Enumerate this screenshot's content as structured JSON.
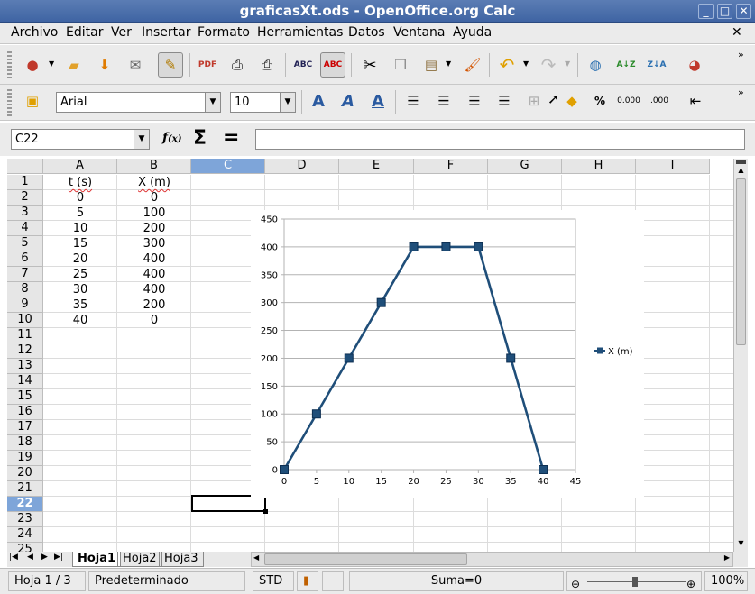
{
  "window": {
    "title": "graficasXt.ods - OpenOffice.org Calc"
  },
  "menu": [
    {
      "label": "Archivo"
    },
    {
      "label": "Editar"
    },
    {
      "label": "Ver"
    },
    {
      "label": "Insertar"
    },
    {
      "label": "Formato"
    },
    {
      "label": "Herramientas"
    },
    {
      "label": "Datos"
    },
    {
      "label": "Ventana"
    },
    {
      "label": "Ayuda"
    }
  ],
  "format_toolbar": {
    "font_name": "Arial",
    "font_size": "10"
  },
  "formula_bar": {
    "cell_ref": "C22",
    "value": ""
  },
  "sheet": {
    "columns": [
      "A",
      "B",
      "C",
      "D",
      "E",
      "F",
      "G",
      "H",
      "I"
    ],
    "selected_column": "C",
    "rows": [
      "1",
      "2",
      "3",
      "4",
      "5",
      "6",
      "7",
      "8",
      "9",
      "10",
      "11",
      "12",
      "13",
      "14",
      "15",
      "16",
      "17",
      "18",
      "19",
      "20",
      "21",
      "22",
      "23",
      "24",
      "25"
    ],
    "selected_row": "22",
    "table": [
      [
        "t (s)",
        "X (m)"
      ],
      [
        "0",
        "0"
      ],
      [
        "5",
        "100"
      ],
      [
        "10",
        "200"
      ],
      [
        "15",
        "300"
      ],
      [
        "20",
        "400"
      ],
      [
        "25",
        "400"
      ],
      [
        "30",
        "400"
      ],
      [
        "35",
        "200"
      ],
      [
        "40",
        "0"
      ]
    ]
  },
  "chart_data": {
    "type": "line",
    "x": [
      0,
      5,
      10,
      15,
      20,
      25,
      30,
      35,
      40
    ],
    "series": [
      {
        "name": "X (m)",
        "values": [
          0,
          100,
          200,
          300,
          400,
          400,
          400,
          200,
          0
        ],
        "color": "#1f4e79"
      }
    ],
    "xlim": [
      0,
      45
    ],
    "ylim": [
      0,
      450
    ],
    "xticks": [
      "0",
      "5",
      "10",
      "15",
      "20",
      "25",
      "30",
      "35",
      "40",
      "45"
    ],
    "yticks": [
      "0",
      "50",
      "100",
      "150",
      "200",
      "250",
      "300",
      "350",
      "400",
      "450"
    ],
    "grid": "horizontal",
    "legend": "right"
  },
  "tabs": {
    "sheets": [
      "Hoja1",
      "Hoja2",
      "Hoja3"
    ],
    "active": "Hoja1"
  },
  "status": {
    "sheet": "Hoja 1 / 3",
    "style": "Predeterminado",
    "mode": "STD",
    "sum": "Suma=0",
    "zoom": "100%"
  }
}
